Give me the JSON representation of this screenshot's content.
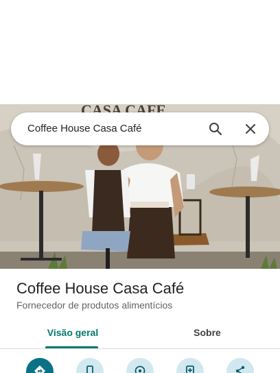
{
  "search": {
    "query": "Coffee House Casa Café"
  },
  "place": {
    "title": "Coffee House Casa Café",
    "category": "Fornecedor de produtos alimentícios"
  },
  "hero": {
    "sign_text": "CASA CAFÉ"
  },
  "tabs": [
    {
      "label": "Visão geral",
      "active": true
    },
    {
      "label": "Sobre",
      "active": false
    }
  ],
  "actions": [
    {
      "icon": "directions-icon"
    },
    {
      "icon": "phone-icon"
    },
    {
      "icon": "nearby-icon"
    },
    {
      "icon": "save-icon"
    },
    {
      "icon": "share-icon"
    }
  ],
  "colors": {
    "accent": "#00796b",
    "action_primary": "#0b7285",
    "action_tonal": "#d2e8f0"
  }
}
